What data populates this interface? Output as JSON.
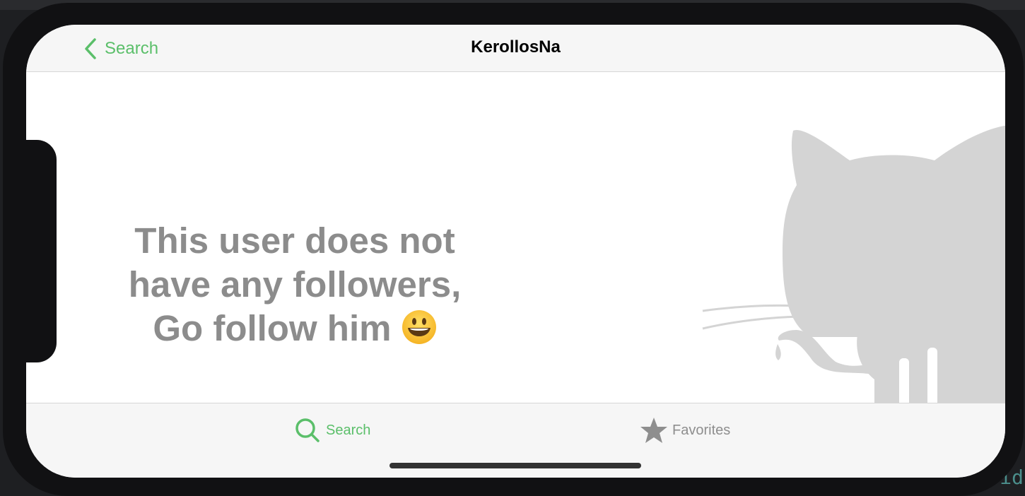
{
  "navbar": {
    "back_label": "Search",
    "title": "KerollosNa"
  },
  "empty_state": {
    "line1": "This user does not",
    "line2": "have any followers,",
    "line3": "Go follow him",
    "emoji": "grinning-face-emoji"
  },
  "tabbar": {
    "tabs": [
      {
        "label": "Search",
        "icon": "magnifying-glass-icon",
        "active": true
      },
      {
        "label": "Favorites",
        "icon": "star-icon",
        "active": false
      }
    ]
  },
  "ide_background": {
    "partial_text": "id"
  },
  "colors": {
    "accent": "#5bbf6a",
    "empty_text": "#8c8c8c",
    "logo_gray": "#d4d4d4",
    "inactive_tab": "#8e8e8e"
  }
}
